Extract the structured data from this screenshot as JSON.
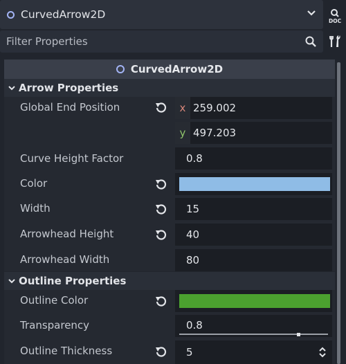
{
  "node_selector": {
    "name": "CurvedArrow2D"
  },
  "filter": {
    "placeholder": "Filter Properties"
  },
  "header": {
    "title": "CurvedArrow2D"
  },
  "sections": {
    "arrow": {
      "label": "Arrow Properties"
    },
    "outline": {
      "label": "Outline Properties"
    }
  },
  "properties": {
    "global_end_position": {
      "label": "Global End Position",
      "x_axis": "x",
      "y_axis": "y",
      "x": "259.002",
      "y": "497.203"
    },
    "curve_height_factor": {
      "label": "Curve Height Factor",
      "value": "0.8"
    },
    "color": {
      "label": "Color",
      "swatch": "#8fbce6"
    },
    "width": {
      "label": "Width",
      "value": "15"
    },
    "arrowhead_height": {
      "label": "Arrowhead Height",
      "value": "40"
    },
    "arrowhead_width": {
      "label": "Arrowhead Width",
      "value": "80"
    },
    "outline_color": {
      "label": "Outline Color",
      "swatch": "#4ba12f"
    },
    "transparency": {
      "label": "Transparency",
      "value": "0.8",
      "slider_fraction": 0.8
    },
    "outline_thickness": {
      "label": "Outline Thickness",
      "value": "5"
    }
  },
  "colors": {
    "axis_x": "#d9877a",
    "axis_y": "#8fc46b",
    "accent": "#a3b4f5"
  }
}
